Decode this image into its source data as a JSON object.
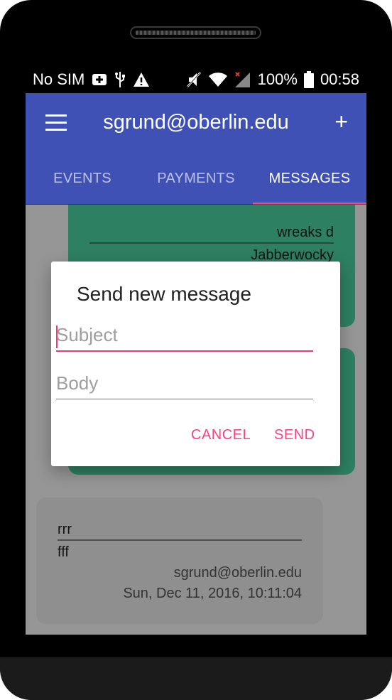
{
  "statusbar": {
    "carrier": "No SIM",
    "battery": "100%",
    "time": "00:58"
  },
  "appbar": {
    "title": "sgrund@oberlin.edu",
    "add_label": "+"
  },
  "tabs": [
    {
      "label": "EVENTS"
    },
    {
      "label": "PAYMENTS"
    },
    {
      "label": "MESSAGES"
    }
  ],
  "messages": [
    {
      "subject": "wreaks d",
      "body": "Jabberwocky"
    },
    {
      "subject": "",
      "body": ""
    },
    {
      "subject": "rrr",
      "body": "fff",
      "sender": "sgrund@oberlin.edu",
      "date": "Sun, Dec 11, 2016, 10:11:04"
    }
  ],
  "dialog": {
    "title": "Send new message",
    "subject_placeholder": "Subject",
    "body_placeholder": "Body",
    "cancel_label": "CANCEL",
    "send_label": "SEND"
  },
  "colors": {
    "primary": "#3f51b5",
    "accent": "#ff4081",
    "card_sent": "#4dd6a3",
    "card_received": "#efefef"
  }
}
